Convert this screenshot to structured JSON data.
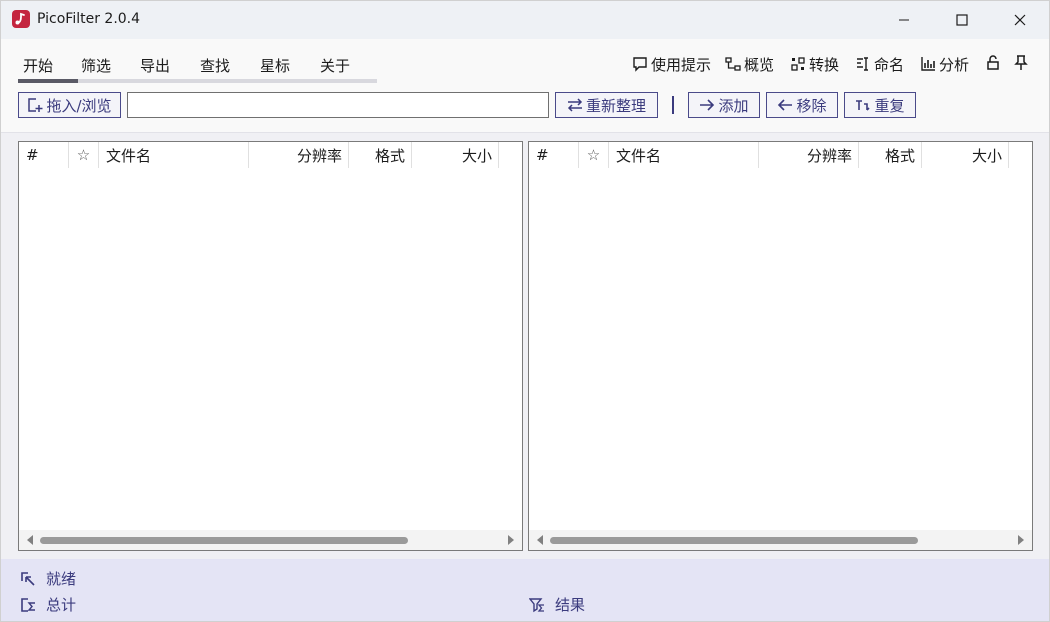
{
  "app": {
    "title": "PicoFilter 2.0.4",
    "accent": "#c4253f",
    "button_color": "#3b3b7e"
  },
  "window_controls": {
    "minimize_icon": "minimize-icon",
    "maximize_icon": "maximize-icon",
    "close_icon": "close-icon"
  },
  "tabs": [
    {
      "label": "开始",
      "active": true
    },
    {
      "label": "筛选",
      "active": false
    },
    {
      "label": "导出",
      "active": false
    },
    {
      "label": "查找",
      "active": false
    },
    {
      "label": "星标",
      "active": false
    },
    {
      "label": "关于",
      "active": false
    }
  ],
  "tools": {
    "tips": "使用提示",
    "overview": "概览",
    "convert": "转换",
    "rename": "命名",
    "analyze": "分析",
    "lock_icon": "lock-icon",
    "pin_icon": "pin-icon"
  },
  "toolbar": {
    "browse_label": "拖入/浏览",
    "path_value": "",
    "reorganize_label": "重新整理",
    "add_label": "添加",
    "remove_label": "移除",
    "duplicate_label": "重复"
  },
  "table": {
    "columns": [
      "#",
      "☆",
      "文件名",
      "分辨率",
      "格式",
      "大小"
    ]
  },
  "status": {
    "ready": "就绪",
    "total": "总计",
    "result": "结果"
  }
}
